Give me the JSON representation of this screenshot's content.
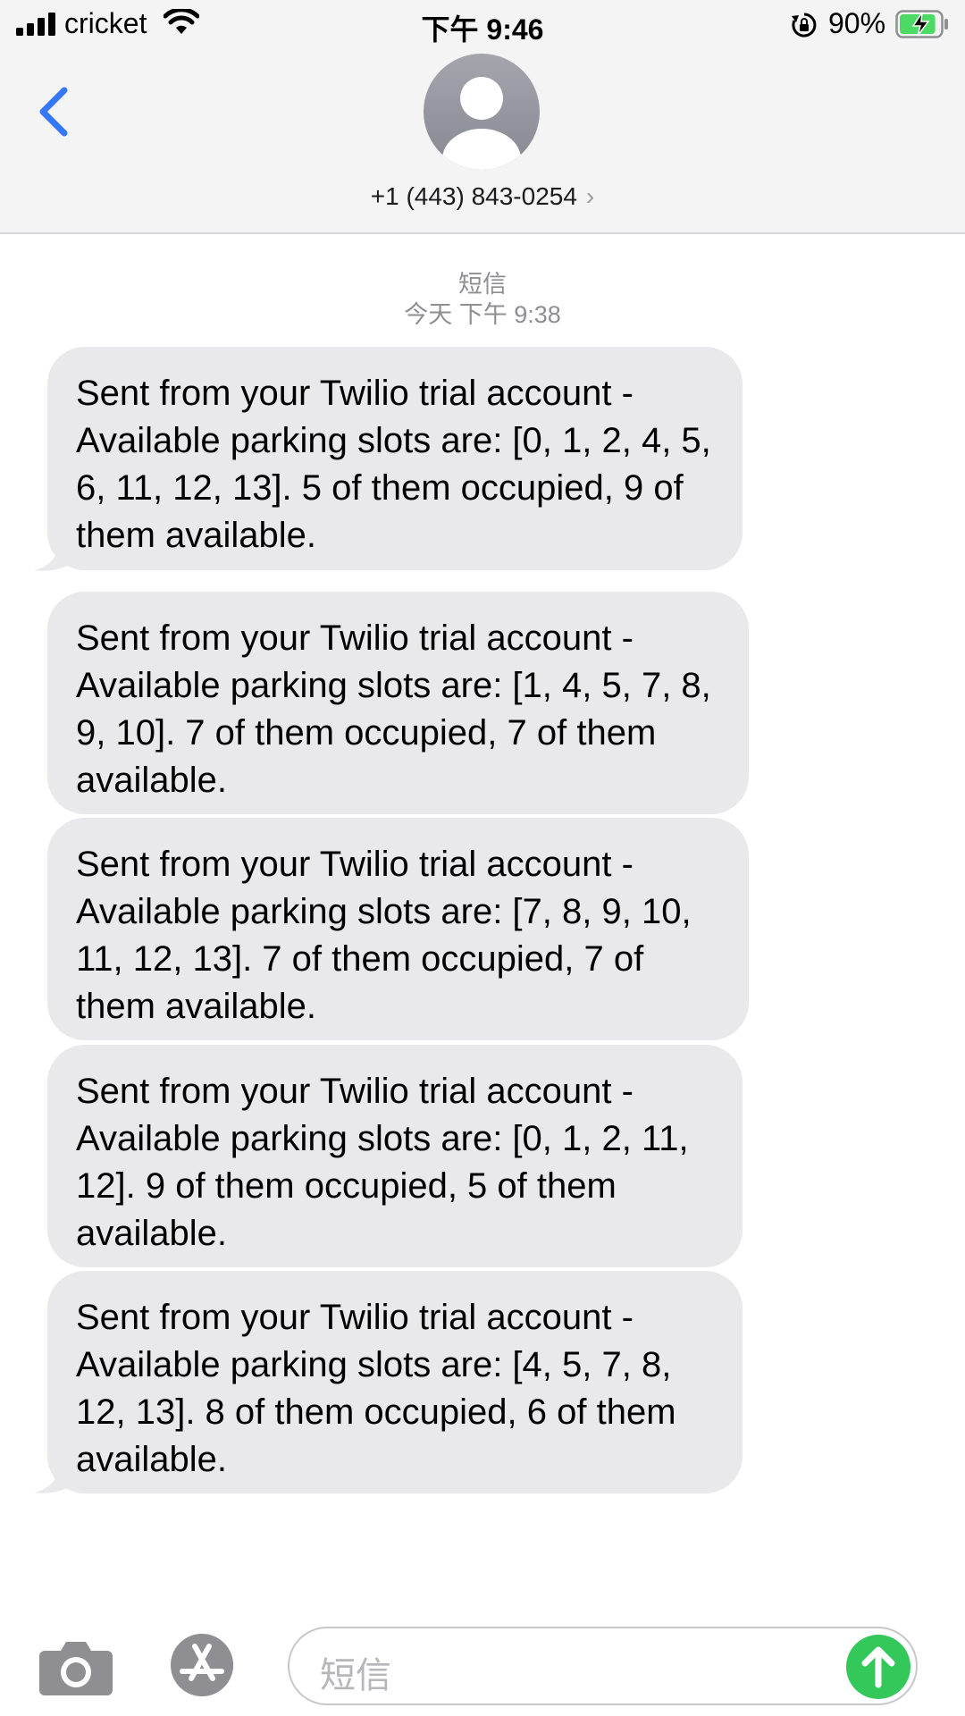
{
  "status_bar": {
    "carrier": "cricket",
    "time": "下午 9:46",
    "battery": "90%",
    "battery_level": 0.9
  },
  "header": {
    "contact": "+1 (443) 843-0254",
    "back_icon": "chevron-left-icon",
    "avatar_icon": "person-icon"
  },
  "conversation": {
    "service_label": "短信",
    "timestamp": "今天 下午 9:38"
  },
  "messages": [
    {
      "text": "Sent from your Twilio trial account - Available parking slots are: [0, 1, 2, 4, 5, 6, 11, 12, 13]. 5 of them occupied, 9 of them available."
    },
    {
      "text": "Sent from your Twilio trial account - Available parking slots are: [1, 4, 5, 7, 8, 9, 10]. 7 of them occupied, 7 of them available."
    },
    {
      "text": "Sent from your Twilio trial account - Available parking slots are: [7, 8, 9, 10, 11, 12, 13]. 7 of them occupied, 7 of them available."
    },
    {
      "text": "Sent from your Twilio trial account - Available parking slots are: [0, 1, 2, 11, 12]. 9 of them occupied, 5 of them available."
    },
    {
      "text": "Sent from your Twilio trial account - Available parking slots are: [4, 5, 7, 8, 12, 13]. 8 of them occupied, 6 of them available."
    }
  ],
  "input_bar": {
    "placeholder": "短信",
    "camera_icon": "camera-icon",
    "apps_icon": "app-store-icon",
    "send_icon": "send-arrow-icon"
  },
  "colors": {
    "accent": "#3478f6",
    "bubble": "#e9e9eb",
    "send": "#34c759",
    "battery": "#4cd964"
  }
}
